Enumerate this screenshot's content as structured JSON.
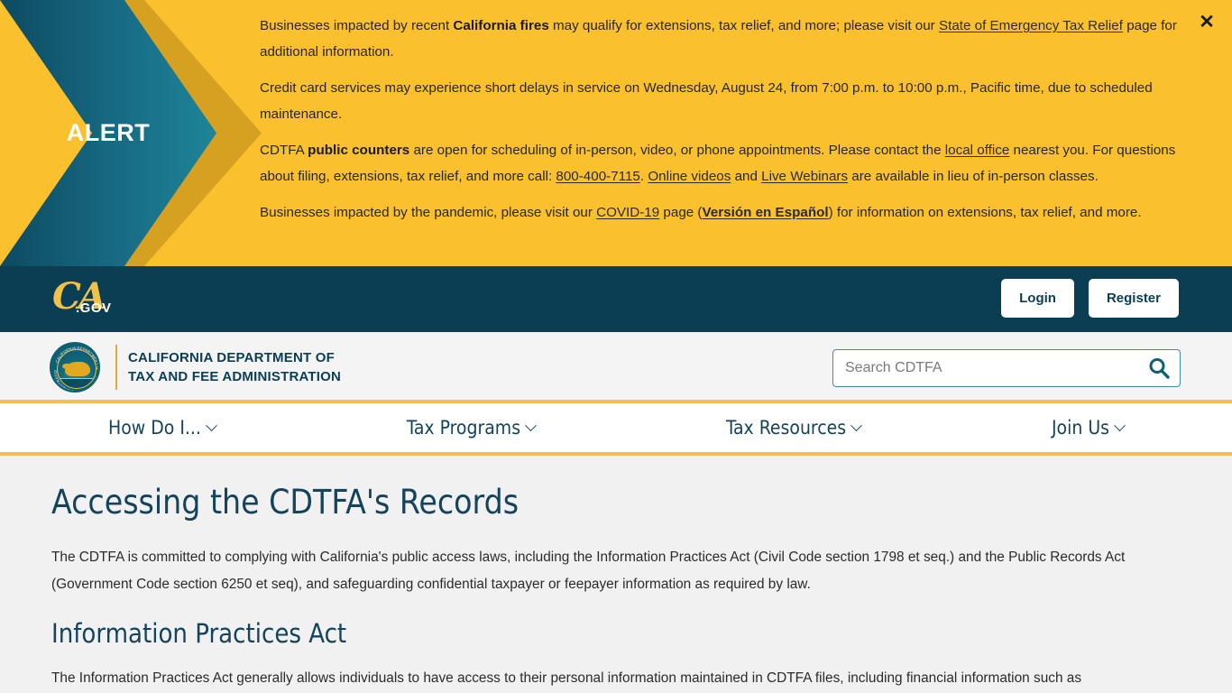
{
  "alert": {
    "label": "ALERT",
    "close_icon": "close-icon",
    "paragraphs": [
      {
        "id": "fires",
        "parts": [
          {
            "t": "text",
            "v": "Businesses impacted by recent "
          },
          {
            "t": "bold",
            "v": "California fires"
          },
          {
            "t": "text",
            "v": " may qualify for extensions, tax relief, and more; please visit our "
          },
          {
            "t": "link",
            "v": "State of Emergency Tax Relief"
          },
          {
            "t": "text",
            "v": " page for additional information."
          }
        ]
      },
      {
        "id": "credit-card",
        "parts": [
          {
            "t": "text",
            "v": "Credit card services may experience short delays in service on Wednesday, August 24, from 7:00 p.m. to 10:00 p.m., Pacific time, due to scheduled maintenance."
          }
        ]
      },
      {
        "id": "public-counters",
        "parts": [
          {
            "t": "text",
            "v": "CDTFA "
          },
          {
            "t": "bold",
            "v": "public counters"
          },
          {
            "t": "text",
            "v": " are open for scheduling of in-person, video, or phone appointments. Please contact the "
          },
          {
            "t": "link",
            "v": "local office"
          },
          {
            "t": "text",
            "v": " nearest you. For questions about filing, extensions, tax relief, and more call: "
          },
          {
            "t": "link",
            "v": "800-400-7115"
          },
          {
            "t": "text",
            "v": ". "
          },
          {
            "t": "link",
            "v": "Online videos"
          },
          {
            "t": "text",
            "v": " and "
          },
          {
            "t": "link",
            "v": "Live Webinars"
          },
          {
            "t": "text",
            "v": " are available in lieu of in-person classes."
          }
        ]
      },
      {
        "id": "pandemic",
        "parts": [
          {
            "t": "text",
            "v": "Businesses impacted by the pandemic, please visit our "
          },
          {
            "t": "link",
            "v": "COVID-19"
          },
          {
            "t": "text",
            "v": " page ("
          },
          {
            "t": "boldlink",
            "v": "Versión en Español"
          },
          {
            "t": "text",
            "v": ") for information on extensions, tax relief, and more."
          }
        ]
      }
    ]
  },
  "ca_bar": {
    "logo_script": "CA",
    "logo_gov": ".GOV",
    "login_label": "Login",
    "register_label": "Register"
  },
  "brand": {
    "seal_alt": "cdtfa-seal",
    "title_line1": "CALIFORNIA DEPARTMENT OF",
    "title_line2": "TAX AND FEE ADMINISTRATION"
  },
  "search": {
    "placeholder": "Search CDTFA",
    "value": "",
    "icon": "search-icon"
  },
  "nav": {
    "items": [
      {
        "label": "How Do I...",
        "icon": "chevron-down-icon"
      },
      {
        "label": "Tax Programs",
        "icon": "chevron-down-icon"
      },
      {
        "label": "Tax Resources",
        "icon": "chevron-down-icon"
      },
      {
        "label": "Join Us",
        "icon": "chevron-down-icon"
      }
    ]
  },
  "main": {
    "page_title": "Accessing the CDTFA's Records",
    "intro": "The CDTFA is committed to complying with California's public access laws, including the Information Practices Act (Civil Code section 1798 et seq.) and the Public Records Act (Government Code section 6250 et seq), and safeguarding confidential taxpayer or feepayer information as required by law.",
    "section_title": "Information Practices Act",
    "section_body": "The Information Practices Act generally allows individuals to have access to their personal information maintained in CDTFA files, including financial information such as"
  },
  "colors": {
    "alert_bg": "#fbc02d",
    "alert_gold_chevron": "#d6a021",
    "teal_dark": "#0b3d53",
    "teal_light": "#1c7f95",
    "nav_text": "#14435c",
    "accent_gold": "#f2c14b"
  }
}
